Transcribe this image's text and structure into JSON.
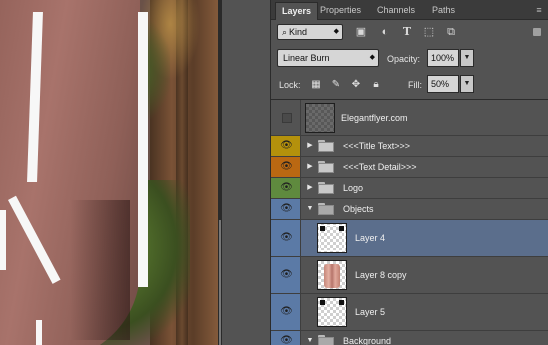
{
  "panel": {
    "tabs": [
      "Layers",
      "Properties",
      "Channels",
      "Paths"
    ],
    "filter": {
      "kind_label": "Kind",
      "icons": [
        "image-filter-icon",
        "adjustment-filter-icon",
        "type-filter-icon",
        "shape-filter-icon",
        "smart-object-filter-icon"
      ]
    },
    "blend_mode": "Linear Burn",
    "opacity_label": "Opacity:",
    "opacity_value": "100%",
    "lock_label": "Lock:",
    "lock_icons": [
      "lock-transparent-pixels-icon",
      "lock-image-pixels-icon",
      "lock-position-icon",
      "lock-all-icon"
    ],
    "fill_label": "Fill:",
    "fill_value": "50%"
  },
  "colors": {
    "label_yellow": "#b4910c",
    "label_orange": "#ba6812",
    "label_green": "#5f8a3e",
    "label_blue": "#5b7aa6",
    "selected_row": "#5b6e8c"
  },
  "layers": [
    {
      "name": "Elegantflyer.com",
      "type": "layer",
      "visible": false,
      "label_color": "none"
    },
    {
      "name": "<<<Title Text>>>",
      "type": "group",
      "expanded": false,
      "visible": true,
      "label_color": "yellow"
    },
    {
      "name": "<<<Text Detail>>>",
      "type": "group",
      "expanded": false,
      "visible": true,
      "label_color": "orange"
    },
    {
      "name": "Logo",
      "type": "group",
      "expanded": false,
      "visible": true,
      "label_color": "green"
    },
    {
      "name": "Objects",
      "type": "group",
      "expanded": true,
      "visible": true,
      "label_color": "blue"
    },
    {
      "name": "Layer 4",
      "type": "layer",
      "visible": true,
      "label_color": "blue",
      "selected": true
    },
    {
      "name": "Layer 8 copy",
      "type": "layer",
      "visible": true,
      "label_color": "blue"
    },
    {
      "name": "Layer 5",
      "type": "layer",
      "visible": true,
      "label_color": "blue"
    },
    {
      "name": "Background",
      "type": "group",
      "expanded": true,
      "visible": true,
      "label_color": "blue"
    }
  ]
}
